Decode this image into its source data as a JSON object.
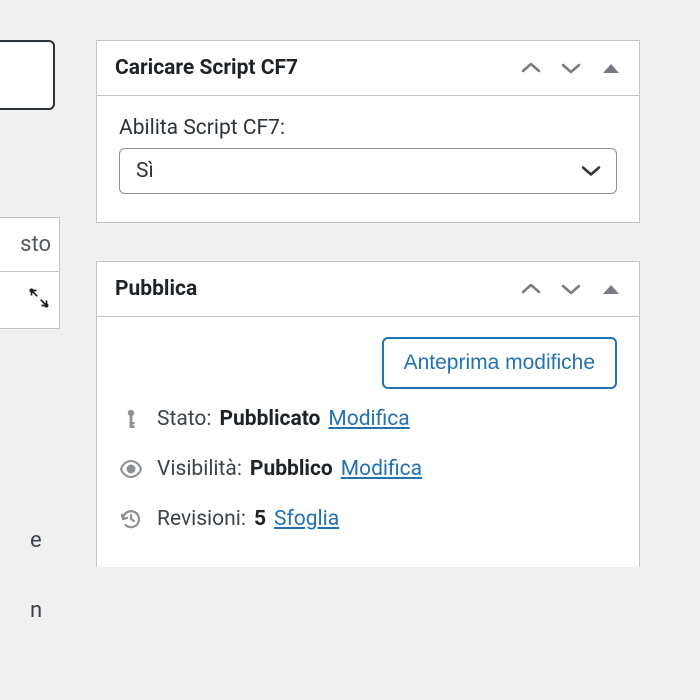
{
  "left": {
    "partial1": "sto",
    "partial2": "e",
    "partial3": "n"
  },
  "box1": {
    "title": "Caricare Script CF7",
    "field_label": "Abilita Script CF7:",
    "select_value": "Sì"
  },
  "box2": {
    "title": "Pubblica",
    "preview_btn": "Anteprima modifiche",
    "status": {
      "label": "Stato:",
      "value": "Pubblicato",
      "edit": "Modifica"
    },
    "visibility": {
      "label": "Visibilità:",
      "value": "Pubblico",
      "edit": "Modifica"
    },
    "revisions": {
      "label": "Revisioni:",
      "value": "5",
      "browse": "Sfoglia"
    }
  }
}
